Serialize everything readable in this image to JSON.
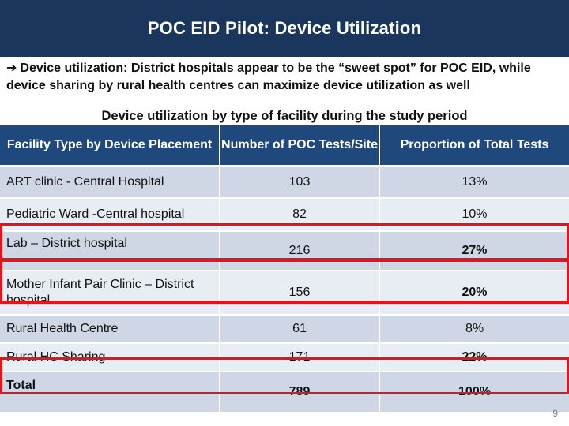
{
  "slide": {
    "title": "POC EID Pilot: Device Utilization",
    "bullet_icon": "arrow-right-icon",
    "bullet_text": "Device utilization: District hospitals appear to be the “sweet spot” for POC EID, while device sharing by rural health centres can maximize device utilization as well",
    "table_caption": "Device utilization by type of facility during the study period",
    "page_number": "9"
  },
  "table": {
    "headers": [
      "Facility Type by Device Placement",
      "Number of POC Tests/Site",
      "Proportion of Total Tests"
    ],
    "rows": [
      {
        "facility": "ART clinic - Central Hospital",
        "tests": "103",
        "proportion": "13%",
        "proportion_bold": false,
        "highlighted": false
      },
      {
        "facility": "Pediatric Ward -Central hospital",
        "tests": "82",
        "proportion": "10%",
        "proportion_bold": false,
        "highlighted": false
      },
      {
        "facility": "Lab – District hospital",
        "tests": "216",
        "proportion": "27%",
        "proportion_bold": true,
        "highlighted": true
      },
      {
        "facility": "Mother Infant Pair Clinic – District hospital",
        "tests": "156",
        "proportion": "20%",
        "proportion_bold": true,
        "highlighted": true
      },
      {
        "facility": "Rural Health Centre",
        "tests": "61",
        "proportion": "8%",
        "proportion_bold": false,
        "highlighted": false
      },
      {
        "facility": "Rural HC Sharing",
        "tests": "171",
        "proportion": "22%",
        "proportion_bold": true,
        "highlighted": false
      }
    ],
    "total": {
      "facility": "Total",
      "tests": "789",
      "proportion": "100%",
      "highlighted": true
    }
  },
  "colors": {
    "title_bar": "#1b365d",
    "table_header": "#1f497d",
    "row_dark": "#cfd6e5",
    "row_light": "#e8ecf3",
    "highlight_border": "#e8121a"
  }
}
